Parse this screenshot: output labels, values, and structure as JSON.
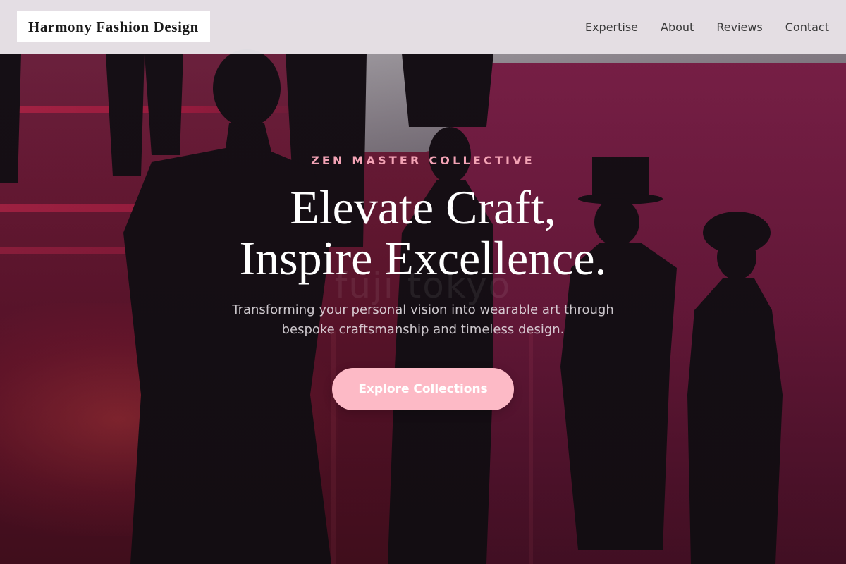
{
  "header": {
    "brand": "Harmony Fashion Design",
    "nav": [
      {
        "label": "Expertise"
      },
      {
        "label": "About"
      },
      {
        "label": "Reviews"
      },
      {
        "label": "Contact"
      }
    ]
  },
  "hero": {
    "eyebrow": "ZEN MASTER COLLECTIVE",
    "headline_line1": "Elevate Craft,",
    "headline_line2": "Inspire Excellence.",
    "subtitle_line1": "Transforming your personal vision into wearable art through",
    "subtitle_line2": "bespoke craftsmanship and timeless design.",
    "cta_label": "Explore Collections",
    "background_watermark": "fuji tokyo"
  },
  "colors": {
    "accent_pink": "#fdbac6",
    "eyebrow_pink": "#f3a3b5",
    "header_bg": "#eceaee",
    "scene_magenta": "#7a1e3d"
  }
}
